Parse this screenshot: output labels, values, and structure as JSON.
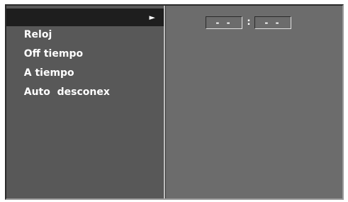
{
  "menu": {
    "items": [
      {
        "label": "Reloj",
        "selected": true,
        "arrow": "►"
      },
      {
        "label": "Off tiempo",
        "selected": false
      },
      {
        "label": "A tiempo",
        "selected": false
      },
      {
        "label": "Auto  desconex",
        "selected": false
      }
    ]
  },
  "clock": {
    "hours": "- -",
    "separator": ":",
    "minutes": "- -"
  },
  "colors": {
    "panel": "#6c6c6c",
    "menu_background": "#585858",
    "selected_background": "#1e1e1e",
    "text": "#ffffff"
  }
}
